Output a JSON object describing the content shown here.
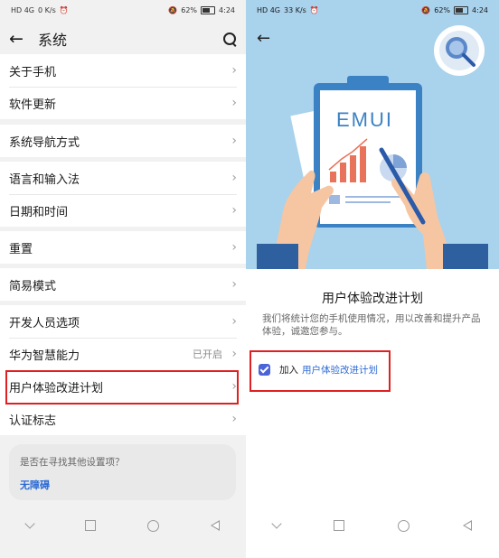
{
  "left": {
    "status": {
      "network": "HD 4G",
      "speed": "0 K/s",
      "battery": "62%",
      "time": "4:24"
    },
    "header": {
      "title": "系统"
    },
    "groups": [
      [
        "关于手机",
        "软件更新"
      ],
      [
        "系统导航方式"
      ],
      [
        "语言和输入法",
        "日期和时间"
      ],
      [
        "重置"
      ],
      [
        "简易模式"
      ],
      [
        "开发人员选项",
        "华为智慧能力",
        "用户体验改进计划",
        "认证标志"
      ]
    ],
    "smart_status": "已开启",
    "suggestion": {
      "question": "是否在寻找其他设置项？",
      "link": "无障碍"
    }
  },
  "right": {
    "status": {
      "network": "HD 4G",
      "speed": "33 K/s",
      "battery": "62%",
      "time": "4:24"
    },
    "hero": {
      "doc_text": "EMUI"
    },
    "heading": "用户体验改进计划",
    "description": "我们将统计您的手机使用情况，用以改善和提升产品体验，诚邀您参与。",
    "join": {
      "prefix": "加入",
      "link": "用户体验改进计划",
      "checked": true
    }
  },
  "colors": {
    "highlight": "#e02020",
    "accent": "#4a63d8",
    "link": "#2c6bd4",
    "hero_bg": "#a9d2ec"
  }
}
